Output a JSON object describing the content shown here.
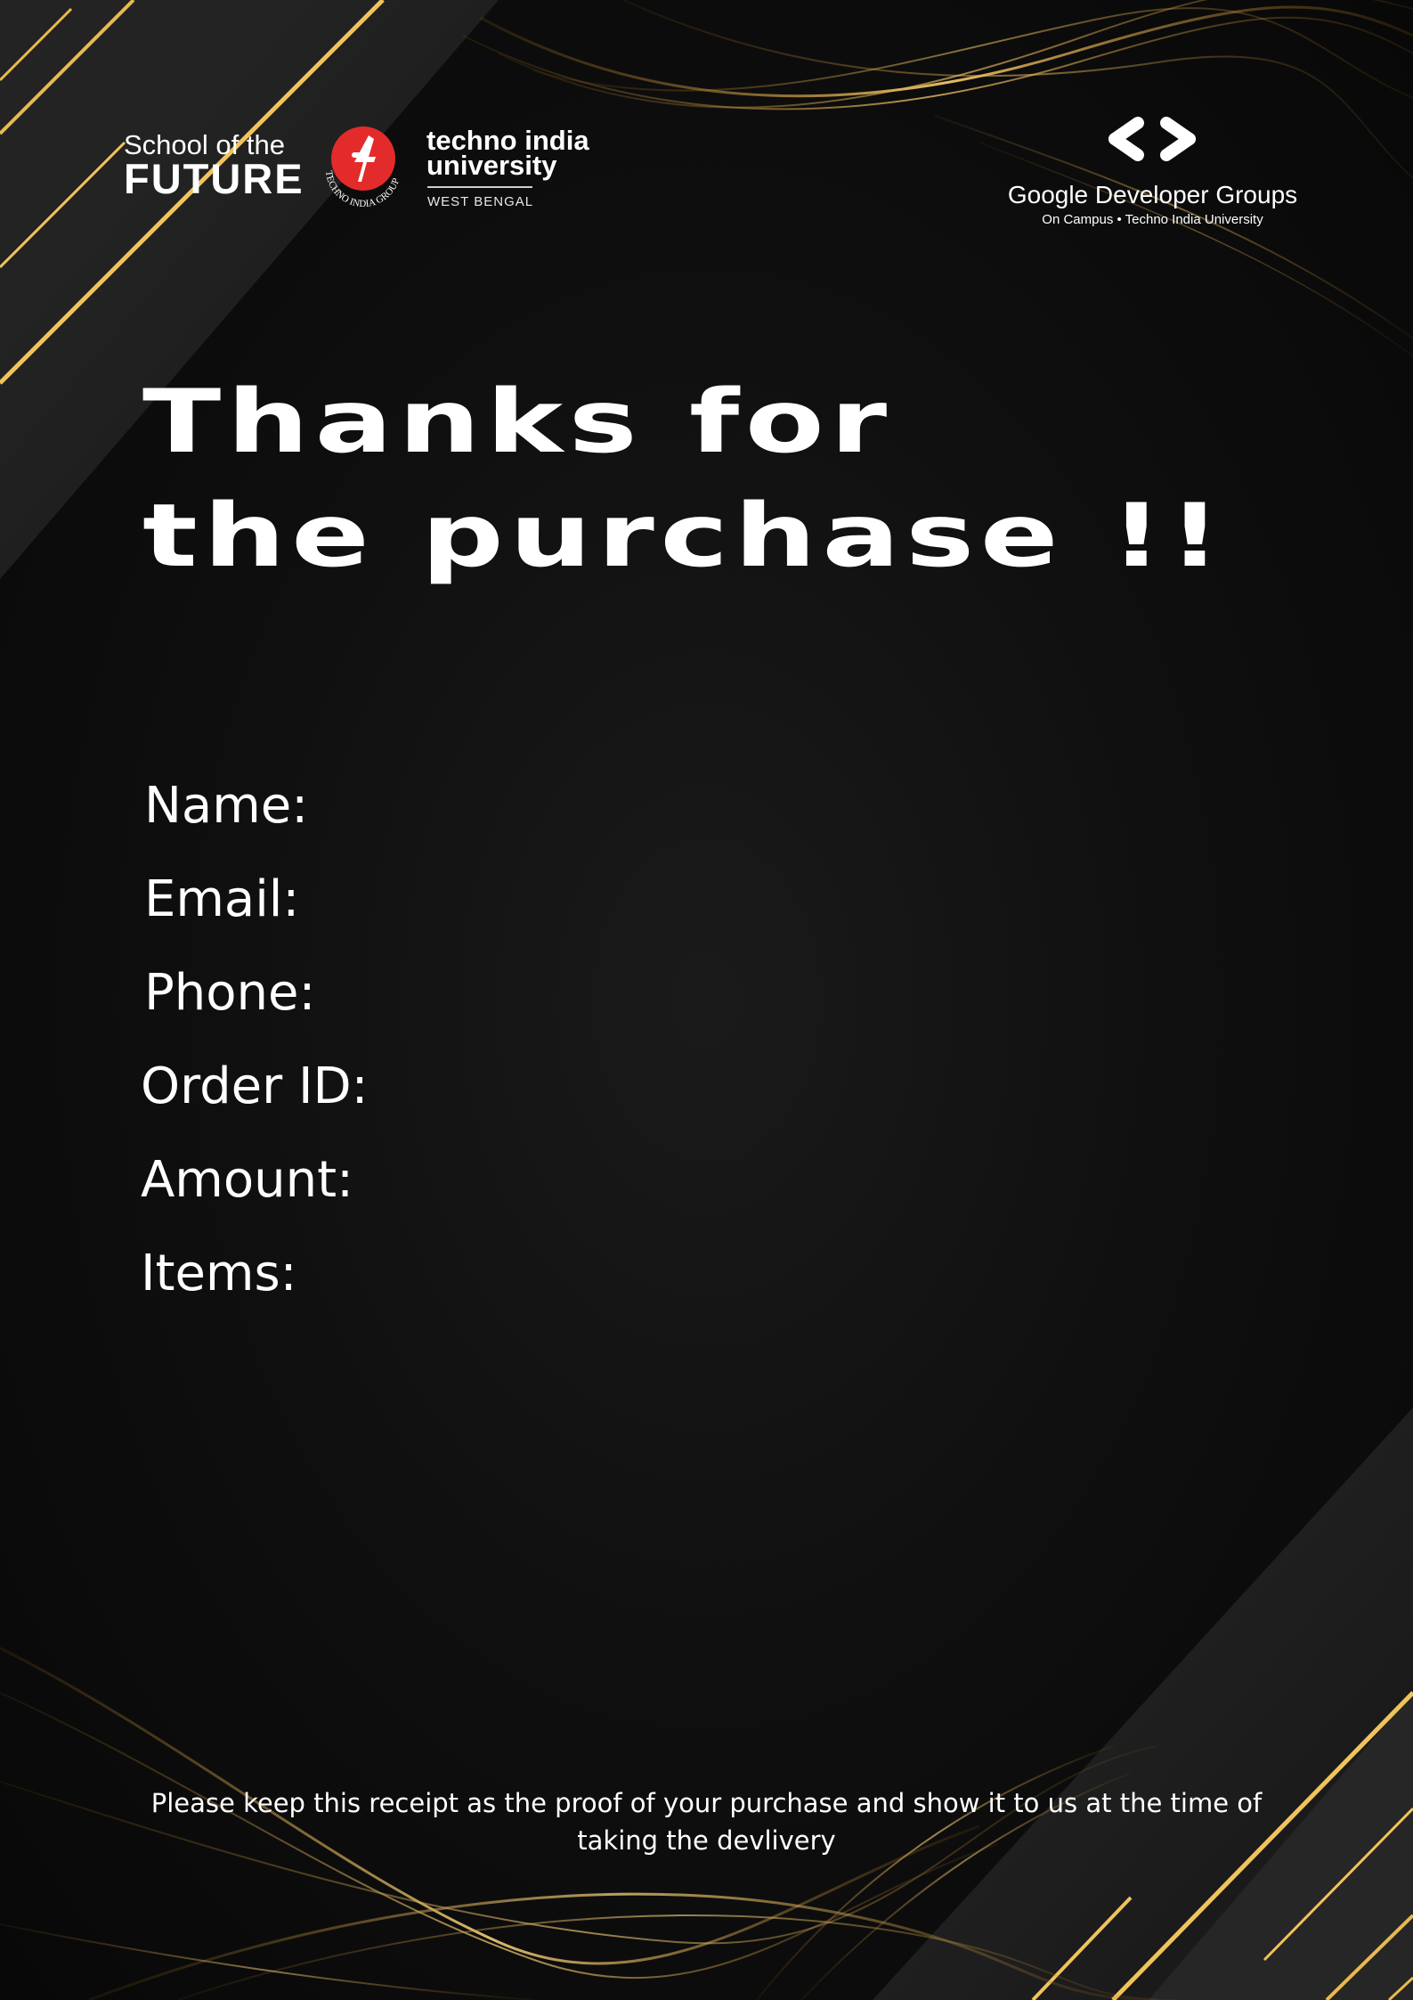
{
  "branding": {
    "school_logo": {
      "line1": "School of the",
      "line2": "FUTURE"
    },
    "university_emblem": {
      "icon": "techno-india-group-emblem",
      "ring_text": "TECHNO INDIA GROUP"
    },
    "university_logo": {
      "name_line1": "techno india",
      "name_line2": "university",
      "region": "WEST BENGAL"
    },
    "community_logo": {
      "icon": "gdg-brackets-icon",
      "name": "Google Developer Groups",
      "subtitle": "On Campus • Techno India University"
    }
  },
  "heading": {
    "line1": "Thanks for",
    "line2": "the purchase !!"
  },
  "fields": [
    {
      "label": "Name:",
      "value": ""
    },
    {
      "label": "Email:",
      "value": ""
    },
    {
      "label": "Phone:",
      "value": ""
    },
    {
      "label": "Order ID:",
      "value": ""
    },
    {
      "label": "Amount:",
      "value": ""
    },
    {
      "label": "Items:",
      "value": ""
    }
  ],
  "footer": {
    "note": "Please keep this receipt as the proof of your purchase and show it to us at the time of taking the devlivery"
  },
  "colors": {
    "background": "#0e0e0e",
    "accent_gold": "#e0b24a",
    "emblem_red": "#e32b2b",
    "text": "#ffffff"
  }
}
